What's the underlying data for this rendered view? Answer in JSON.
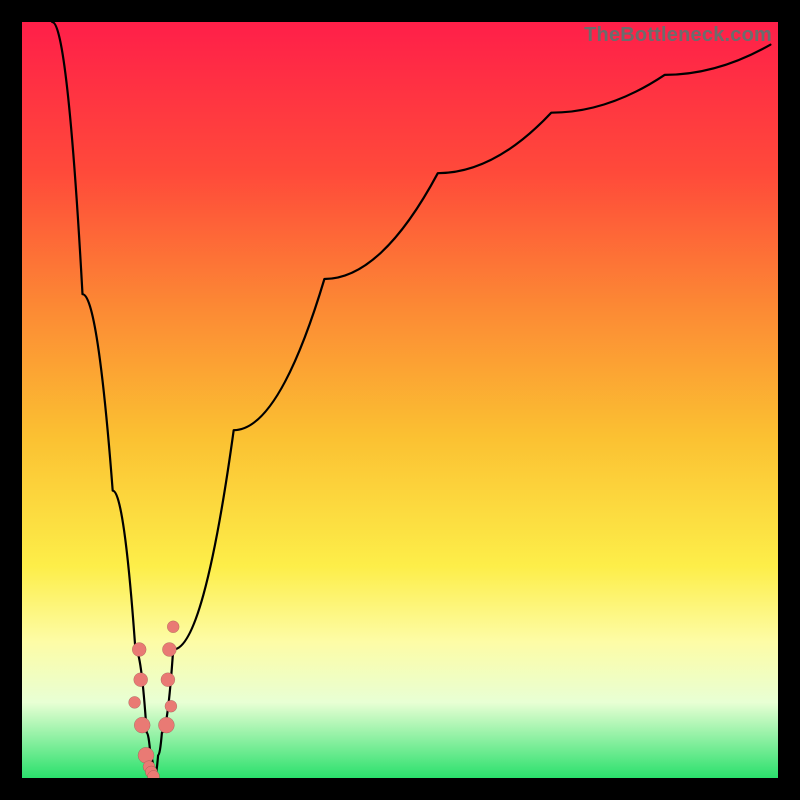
{
  "watermark": "TheBottleneck.com",
  "colors": {
    "frame_bg": "#000000",
    "gradient_top": "#ff1f49",
    "gradient_bottom": "#2ae06c",
    "marker": "#e97a74",
    "curve": "#000000"
  },
  "chart_data": {
    "type": "line",
    "title": "",
    "xlabel": "",
    "ylabel": "",
    "xlim": [
      0,
      100
    ],
    "ylim": [
      0,
      100
    ],
    "origin": "top-left",
    "grid": false,
    "annotations": [],
    "series": [
      {
        "name": "left-branch",
        "x": [
          4,
          8,
          12,
          15,
          16.5,
          17,
          17.5
        ],
        "y": [
          0,
          36,
          62,
          83,
          94,
          97,
          100
        ]
      },
      {
        "name": "right-branch",
        "x": [
          17.5,
          18,
          18.5,
          20,
          28,
          40,
          55,
          70,
          85,
          99
        ],
        "y": [
          100,
          97,
          94,
          83,
          54,
          34,
          20,
          12,
          7,
          3
        ]
      }
    ],
    "markers": {
      "name": "observations",
      "x": [
        15.5,
        15.7,
        15.9,
        14.9,
        16.4,
        16.8,
        17.1,
        17.4,
        19.5,
        19.3,
        19.1,
        19.7,
        20.0
      ],
      "y": [
        83,
        87,
        93,
        90,
        97,
        98.5,
        99.2,
        99.8,
        83,
        87,
        93,
        90.5,
        80
      ],
      "r": [
        7,
        7,
        8,
        6,
        8,
        6,
        6,
        6,
        7,
        7,
        8,
        6,
        6
      ]
    }
  }
}
